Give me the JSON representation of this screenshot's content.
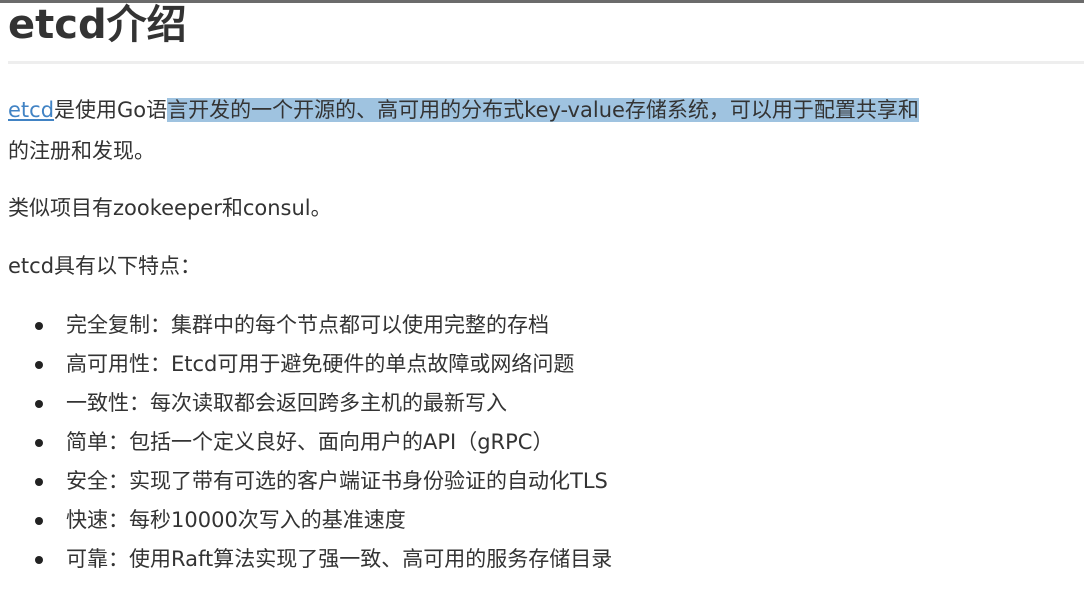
{
  "doc": {
    "title": "etcd介绍",
    "intro": {
      "link_text": "etcd",
      "text_before_highlight": "是使用Go语",
      "highlighted": "言开发的一个开源的、高可用的分布式key-value存储系统，可以用于配置共享和",
      "continuation": "的注册和发现。"
    },
    "similar": "类似项目有zookeeper和consul。",
    "features_heading": "etcd具有以下特点：",
    "features": [
      "完全复制：集群中的每个节点都可以使用完整的存档",
      "高可用性：Etcd可用于避免硬件的单点故障或网络问题",
      "一致性：每次读取都会返回跨多主机的最新写入",
      "简单：包括一个定义良好、面向用户的API（gRPC）",
      "安全：实现了带有可选的客户端证书身份验证的自动化TLS",
      "快速：每秒10000次写入的基准速度",
      "可靠：使用Raft算法实现了强一致、高可用的服务存储目录"
    ]
  }
}
